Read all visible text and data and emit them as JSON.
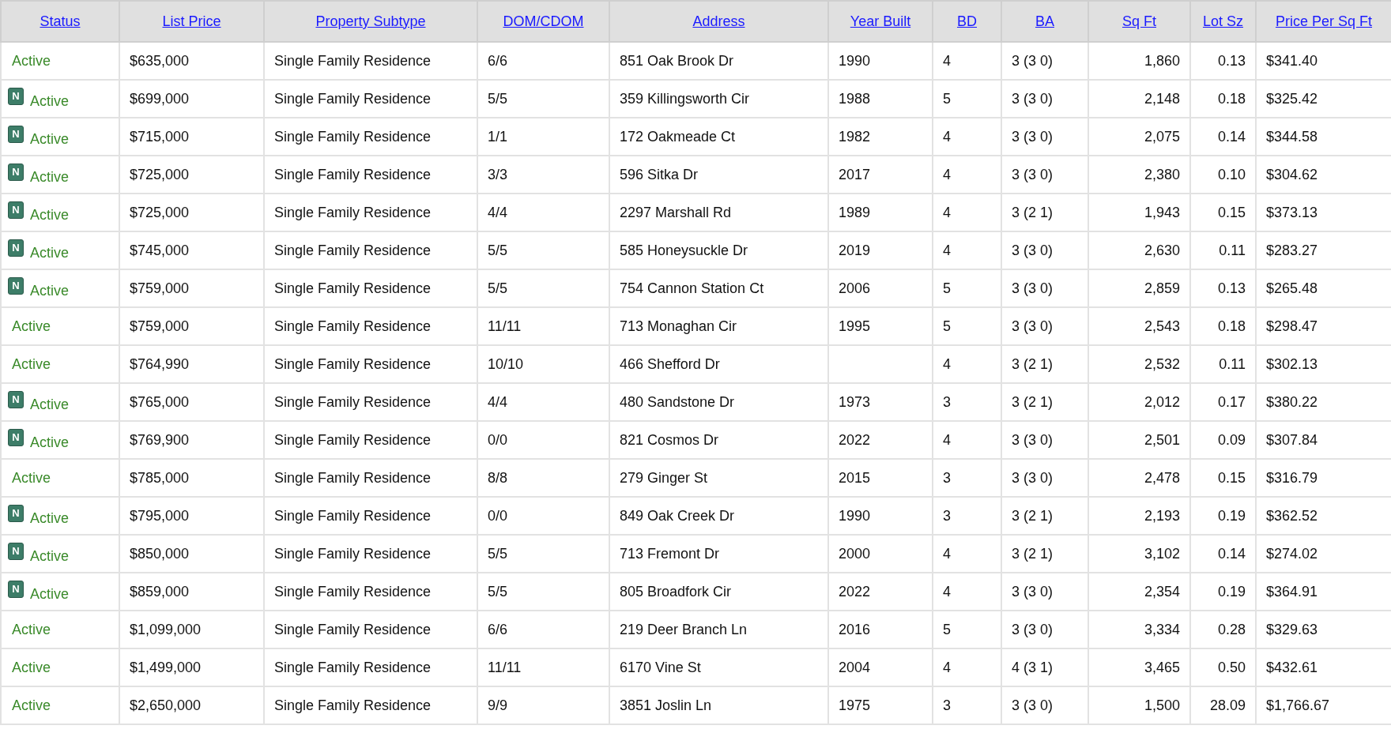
{
  "table": {
    "columns": [
      "Status",
      "List Price",
      "Property Subtype",
      "DOM/CDOM",
      "Address",
      "Year Built",
      "BD",
      "BA",
      "Sq Ft",
      "Lot Sz",
      "Price Per Sq Ft"
    ],
    "rows": [
      {
        "cells": [
          "Active",
          "$635,000",
          "Single Family Residence",
          "6/6",
          "851 Oak Brook Dr",
          "1990",
          "4",
          "3 (3 0)",
          "1,860",
          "0.13",
          "$341.40"
        ]
      },
      {
        "badge": "N",
        "cells": [
          "Active",
          "$699,000",
          "Single Family Residence",
          "5/5",
          "359 Killingsworth Cir",
          "1988",
          "5",
          "3 (3 0)",
          "2,148",
          "0.18",
          "$325.42"
        ]
      },
      {
        "badge": "N",
        "cells": [
          "Active",
          "$715,000",
          "Single Family Residence",
          "1/1",
          "172 Oakmeade Ct",
          "1982",
          "4",
          "3 (3 0)",
          "2,075",
          "0.14",
          "$344.58"
        ]
      },
      {
        "badge": "N",
        "cells": [
          "Active",
          "$725,000",
          "Single Family Residence",
          "3/3",
          "596 Sitka Dr",
          "2017",
          "4",
          "3 (3 0)",
          "2,380",
          "0.10",
          "$304.62"
        ]
      },
      {
        "badge": "N",
        "cells": [
          "Active",
          "$725,000",
          "Single Family Residence",
          "4/4",
          "2297 Marshall Rd",
          "1989",
          "4",
          "3 (2 1)",
          "1,943",
          "0.15",
          "$373.13"
        ]
      },
      {
        "badge": "N",
        "cells": [
          "Active",
          "$745,000",
          "Single Family Residence",
          "5/5",
          "585 Honeysuckle Dr",
          "2019",
          "4",
          "3 (3 0)",
          "2,630",
          "0.11",
          "$283.27"
        ]
      },
      {
        "badge": "N",
        "cells": [
          "Active",
          "$759,000",
          "Single Family Residence",
          "5/5",
          "754 Cannon Station Ct",
          "2006",
          "5",
          "3 (3 0)",
          "2,859",
          "0.13",
          "$265.48"
        ]
      },
      {
        "cells": [
          "Active",
          "$759,000",
          "Single Family Residence",
          "11/11",
          "713 Monaghan Cir",
          "1995",
          "5",
          "3 (3 0)",
          "2,543",
          "0.18",
          "$298.47"
        ]
      },
      {
        "cells": [
          "Active",
          "$764,990",
          "Single Family Residence",
          "10/10",
          "466 Shefford Dr",
          null,
          "4",
          "3 (2 1)",
          "2,532",
          "0.11",
          "$302.13"
        ]
      },
      {
        "badge": "N",
        "cells": [
          "Active",
          "$765,000",
          "Single Family Residence",
          "4/4",
          "480 Sandstone Dr",
          "1973",
          "3",
          "3 (2 1)",
          "2,012",
          "0.17",
          "$380.22"
        ]
      },
      {
        "badge": "N",
        "cells": [
          "Active",
          "$769,900",
          "Single Family Residence",
          "0/0",
          "821 Cosmos Dr",
          "2022",
          "4",
          "3 (3 0)",
          "2,501",
          "0.09",
          "$307.84"
        ]
      },
      {
        "cells": [
          "Active",
          "$785,000",
          "Single Family Residence",
          "8/8",
          "279 Ginger St",
          "2015",
          "3",
          "3 (3 0)",
          "2,478",
          "0.15",
          "$316.79"
        ]
      },
      {
        "badge": "N",
        "cells": [
          "Active",
          "$795,000",
          "Single Family Residence",
          "0/0",
          "849 Oak Creek Dr",
          "1990",
          "3",
          "3 (2 1)",
          "2,193",
          "0.19",
          "$362.52"
        ]
      },
      {
        "badge": "N",
        "cells": [
          "Active",
          "$850,000",
          "Single Family Residence",
          "5/5",
          "713 Fremont Dr",
          "2000",
          "4",
          "3 (2 1)",
          "3,102",
          "0.14",
          "$274.02"
        ]
      },
      {
        "badge": "N",
        "cells": [
          "Active",
          "$859,000",
          "Single Family Residence",
          "5/5",
          "805 Broadfork Cir",
          "2022",
          "4",
          "3 (3 0)",
          "2,354",
          "0.19",
          "$364.91"
        ]
      },
      {
        "cells": [
          "Active",
          "$1,099,000",
          "Single Family Residence",
          "6/6",
          "219 Deer Branch Ln",
          "2016",
          "5",
          "3 (3 0)",
          "3,334",
          "0.28",
          "$329.63"
        ]
      },
      {
        "cells": [
          "Active",
          "$1,499,000",
          "Single Family Residence",
          "11/11",
          "6170 Vine St",
          "2004",
          "4",
          "4 (3 1)",
          "3,465",
          "0.50",
          "$432.61"
        ]
      },
      {
        "cells": [
          "Active",
          "$2,650,000",
          "Single Family Residence",
          "9/9",
          "3851 Joslin Ln",
          "1975",
          "3",
          "3 (3 0)",
          "1,500",
          "28.09",
          "$1,766.67"
        ]
      }
    ]
  }
}
